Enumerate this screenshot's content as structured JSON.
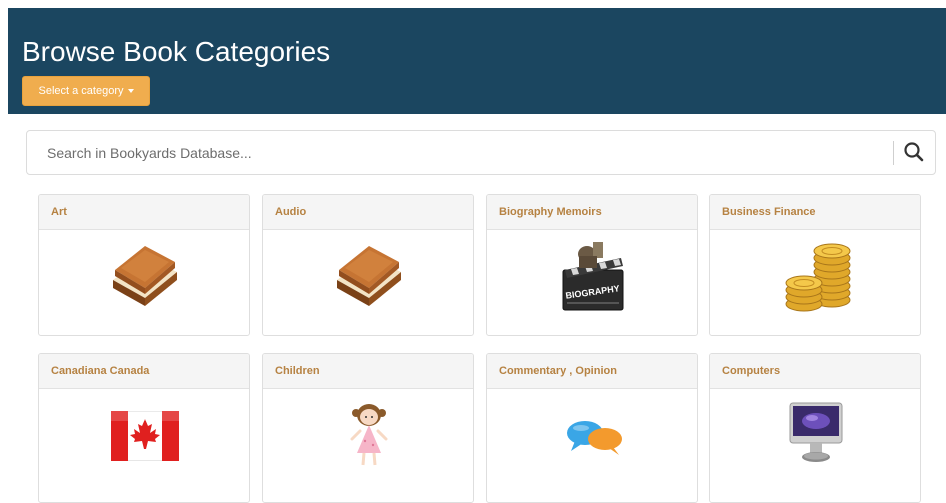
{
  "header": {
    "title": "Browse Book Categories",
    "category_button": "Select a category",
    "bg_color": "#1b4660",
    "button_color": "#f0ad4e"
  },
  "search": {
    "placeholder": "Search in Bookyards Database...",
    "icon": "search-icon"
  },
  "categories": [
    {
      "label": "Art",
      "icon": "books-icon"
    },
    {
      "label": "Audio",
      "icon": "books-icon"
    },
    {
      "label": "Biography Memoirs",
      "icon": "biography-clapperboard-icon"
    },
    {
      "label": "Business Finance",
      "icon": "gold-coins-icon"
    },
    {
      "label": "Canadiana Canada",
      "icon": "canada-flag-icon"
    },
    {
      "label": "Children",
      "icon": "girl-doll-icon"
    },
    {
      "label": "Commentary , Opinion",
      "icon": "speech-bubbles-icon"
    },
    {
      "label": "Computers",
      "icon": "computer-monitor-icon"
    }
  ],
  "biography_icon_text": "BIOGRAPHY",
  "accent_color": "#b68242"
}
